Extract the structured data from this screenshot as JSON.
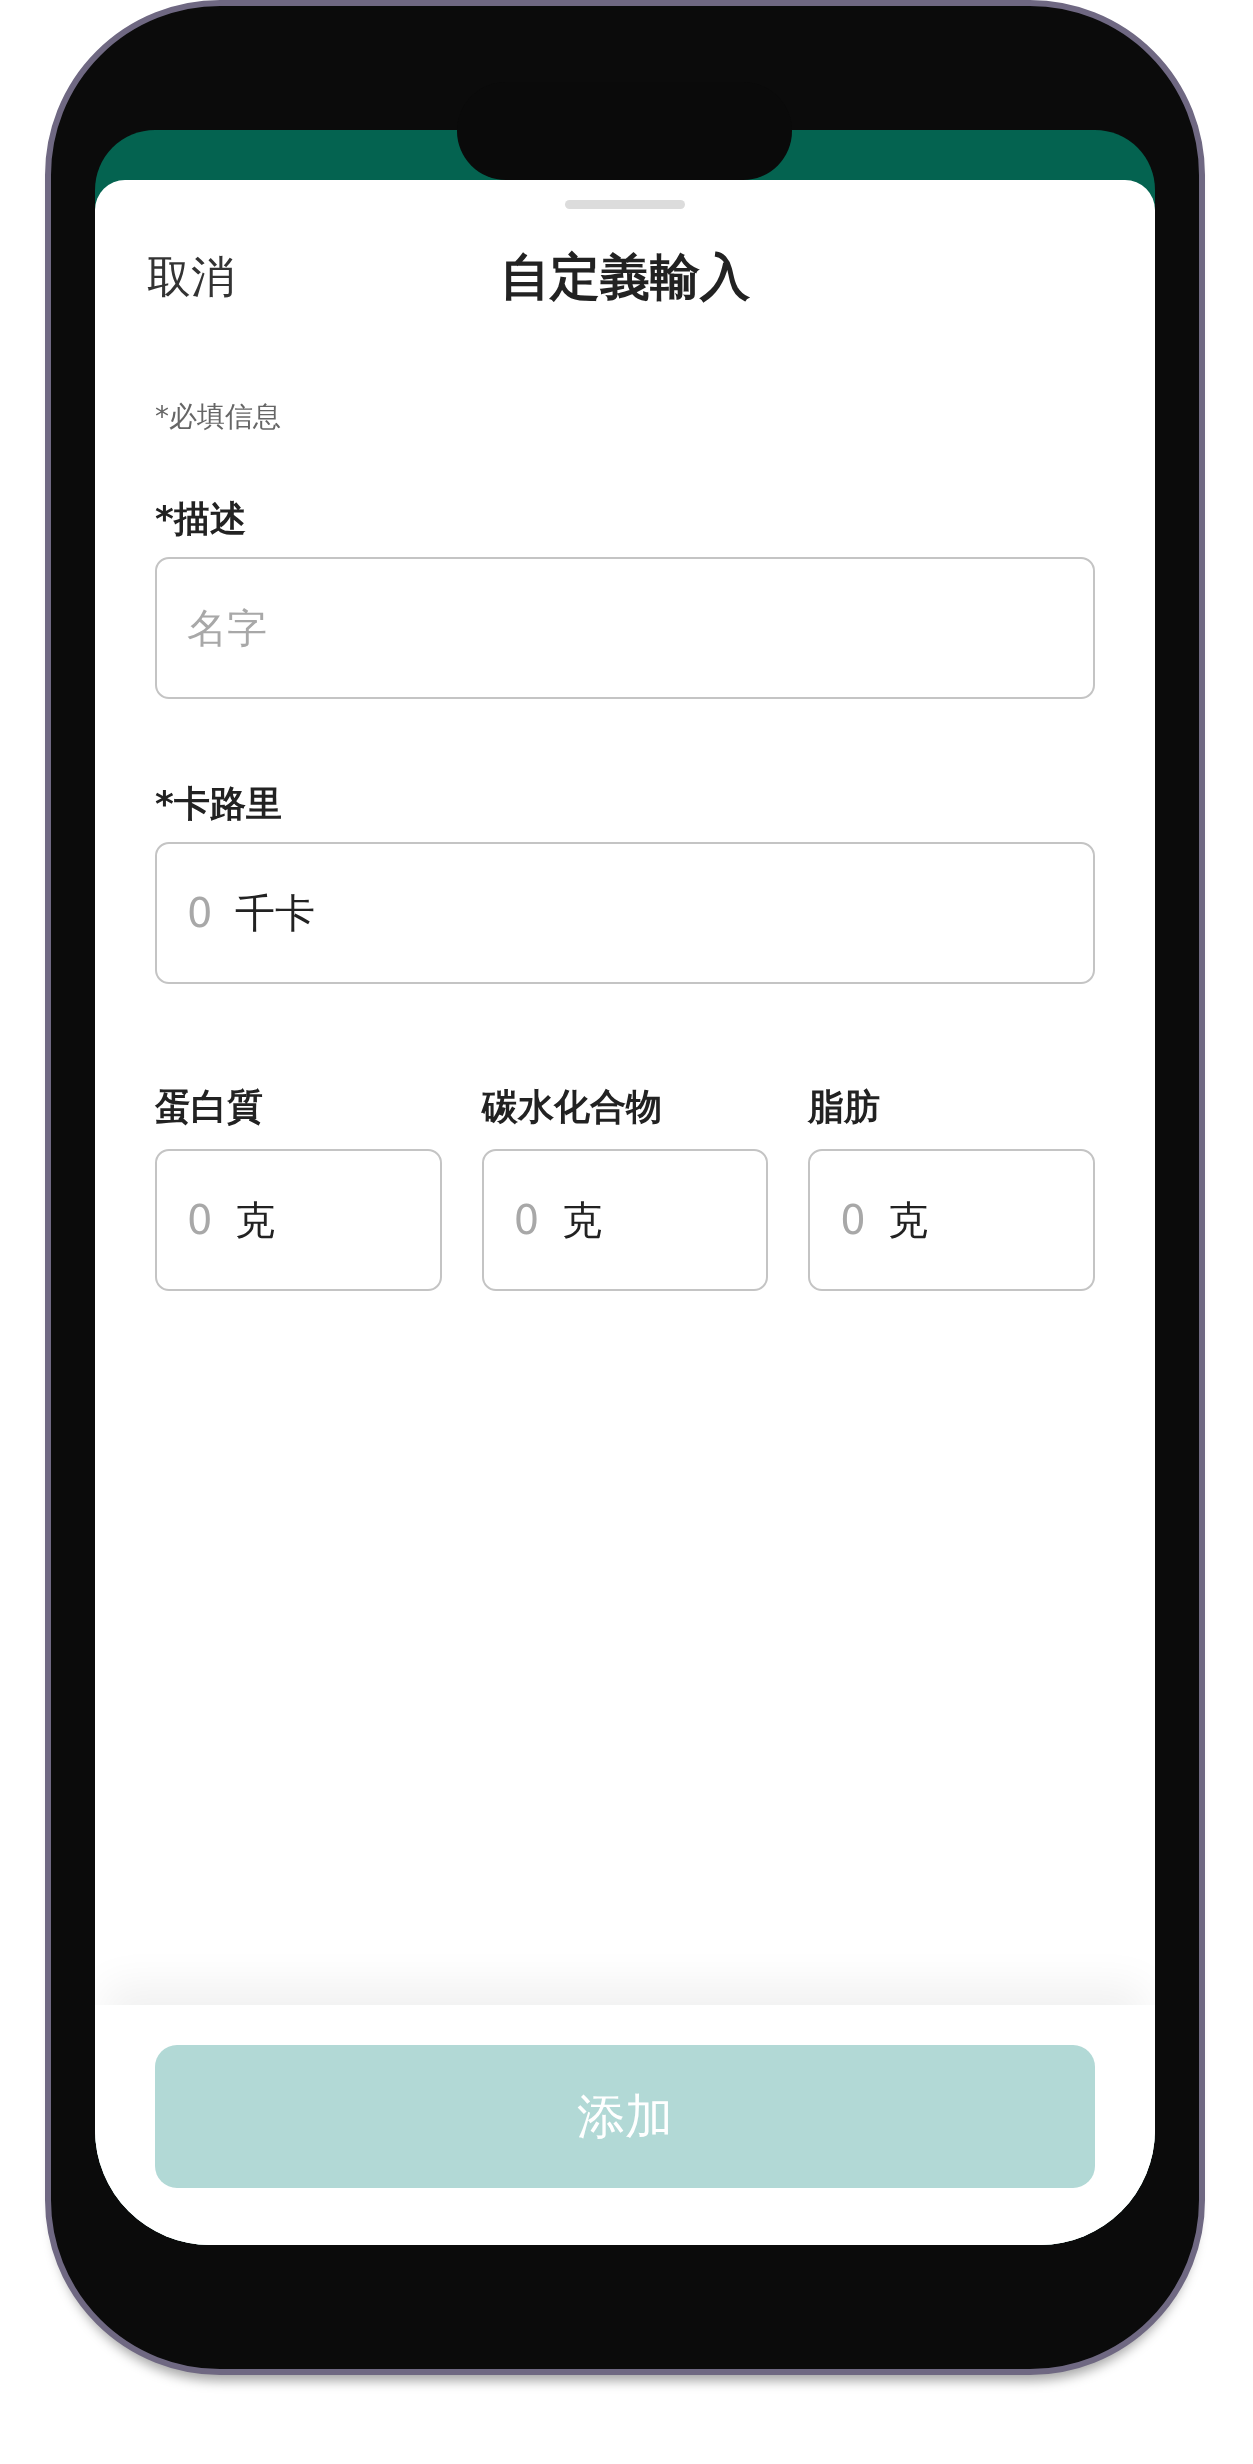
{
  "header": {
    "cancel": "取消",
    "title": "自定義輸入"
  },
  "required_note": "*必填信息",
  "fields": [
    {
      "label": "*描述",
      "placeholder": "名字"
    },
    {
      "label": "*卡路里",
      "placeholder": "0",
      "unit": "千卡"
    }
  ],
  "macros": [
    {
      "label": "蛋白質",
      "placeholder": "0",
      "unit": "克"
    },
    {
      "label": "碳水化合物",
      "placeholder": "0",
      "unit": "克"
    },
    {
      "label": "脂肪",
      "placeholder": "0",
      "unit": "克"
    }
  ],
  "add_button": {
    "label": "添加",
    "disabled": true
  }
}
